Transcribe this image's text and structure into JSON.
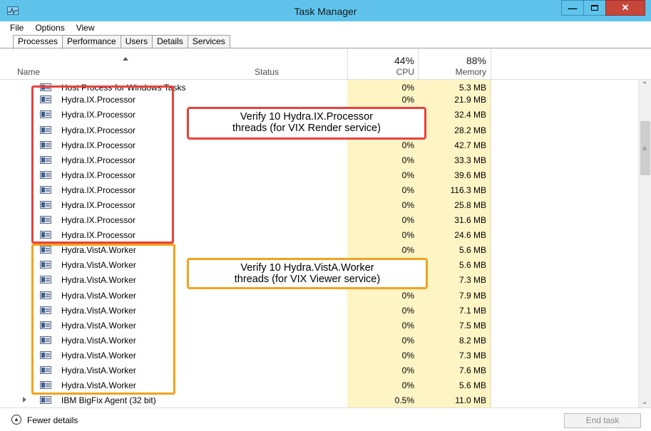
{
  "window": {
    "title": "Task Manager"
  },
  "menu": [
    "File",
    "Options",
    "View"
  ],
  "tabs": [
    "Processes",
    "Performance",
    "Users",
    "Details",
    "Services"
  ],
  "columns": {
    "name": "Name",
    "status": "Status",
    "cpu_total": "44%",
    "cpu": "CPU",
    "mem_total": "88%",
    "mem": "Memory"
  },
  "rows": [
    {
      "name": "Host Process for Windows Tasks",
      "cpu": "0%",
      "mem": "5.3 MB"
    },
    {
      "name": "Hydra.IX.Processor",
      "cpu": "0%",
      "mem": "21.9 MB"
    },
    {
      "name": "Hydra.IX.Processor",
      "cpu": "0%",
      "mem": "32.4 MB"
    },
    {
      "name": "Hydra.IX.Processor",
      "cpu": "",
      "mem": "28.2 MB"
    },
    {
      "name": "Hydra.IX.Processor",
      "cpu": "0%",
      "mem": "42.7 MB"
    },
    {
      "name": "Hydra.IX.Processor",
      "cpu": "0%",
      "mem": "33.3 MB"
    },
    {
      "name": "Hydra.IX.Processor",
      "cpu": "0%",
      "mem": "39.6 MB"
    },
    {
      "name": "Hydra.IX.Processor",
      "cpu": "0%",
      "mem": "116.3 MB"
    },
    {
      "name": "Hydra.IX.Processor",
      "cpu": "0%",
      "mem": "25.8 MB"
    },
    {
      "name": "Hydra.IX.Processor",
      "cpu": "0%",
      "mem": "31.6 MB"
    },
    {
      "name": "Hydra.IX.Processor",
      "cpu": "0%",
      "mem": "24.6 MB"
    },
    {
      "name": "Hydra.VistA.Worker",
      "cpu": "0%",
      "mem": "5.6 MB"
    },
    {
      "name": "Hydra.VistA.Worker",
      "cpu": "0%",
      "mem": "5.6 MB"
    },
    {
      "name": "Hydra.VistA.Worker",
      "cpu": "0%",
      "mem": "7.3 MB"
    },
    {
      "name": "Hydra.VistA.Worker",
      "cpu": "0%",
      "mem": "7.9 MB"
    },
    {
      "name": "Hydra.VistA.Worker",
      "cpu": "0%",
      "mem": "7.1 MB"
    },
    {
      "name": "Hydra.VistA.Worker",
      "cpu": "0%",
      "mem": "7.5 MB"
    },
    {
      "name": "Hydra.VistA.Worker",
      "cpu": "0%",
      "mem": "8.2 MB"
    },
    {
      "name": "Hydra.VistA.Worker",
      "cpu": "0%",
      "mem": "7.3 MB"
    },
    {
      "name": "Hydra.VistA.Worker",
      "cpu": "0%",
      "mem": "7.6 MB"
    },
    {
      "name": "Hydra.VistA.Worker",
      "cpu": "0%",
      "mem": "5.6 MB"
    },
    {
      "name": "IBM BigFix Agent (32 bit)",
      "cpu": "0.5%",
      "mem": "11.0 MB",
      "expandable": true
    }
  ],
  "annotations": {
    "ix": {
      "line1": "Verify 10 Hydra.IX.Processor",
      "line2": "threads (for VIX Render service)",
      "color": "#e8413c"
    },
    "vista": {
      "line1": "Verify 10 Hydra.VistA.Worker",
      "line2": "threads  (for VIX Viewer service)",
      "color": "#f2a31d"
    }
  },
  "footer": {
    "fewer_details": "Fewer details",
    "end_task": "End task"
  },
  "colors": {
    "titlebar": "#5fc3ec",
    "highlight_column": "#fff4c4",
    "close_button": "#c7463a"
  }
}
